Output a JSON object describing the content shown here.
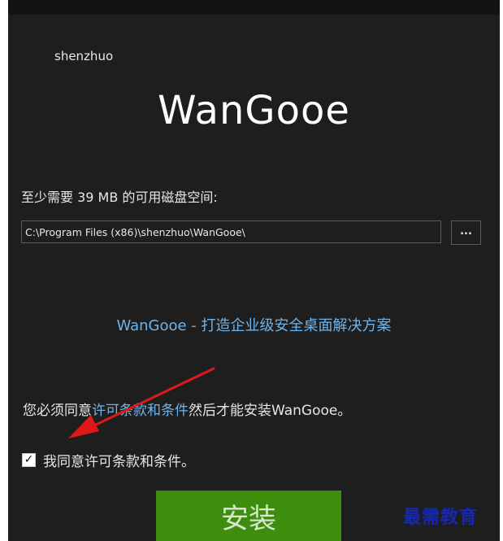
{
  "brand": "shenzhuo",
  "app_title": "WanGooe",
  "disk_space_label": "至少需要 39 MB 的可用磁盘空间:",
  "install_path": {
    "value": "C:\\Program Files (x86)\\shenzhuo\\WanGooe\\",
    "browse_label": "..."
  },
  "tagline": "WanGooe - 打造企业级安全桌面解决方案",
  "agreement": {
    "prefix": "您必须同意",
    "link": "许可条款和条件",
    "suffix": "然后才能安装WanGooe。"
  },
  "checkbox": {
    "checked": true,
    "label": "我同意许可条款和条件。"
  },
  "install_button_label": "安装",
  "watermark": "最需教育",
  "colors": {
    "background": "#1e1e1e",
    "link": "#6cb4ec",
    "install_button": "#3e8d0e",
    "annotation_arrow": "#e01818"
  },
  "icons": {
    "checkbox": "checkmark-icon",
    "annotation": "red-arrow"
  }
}
